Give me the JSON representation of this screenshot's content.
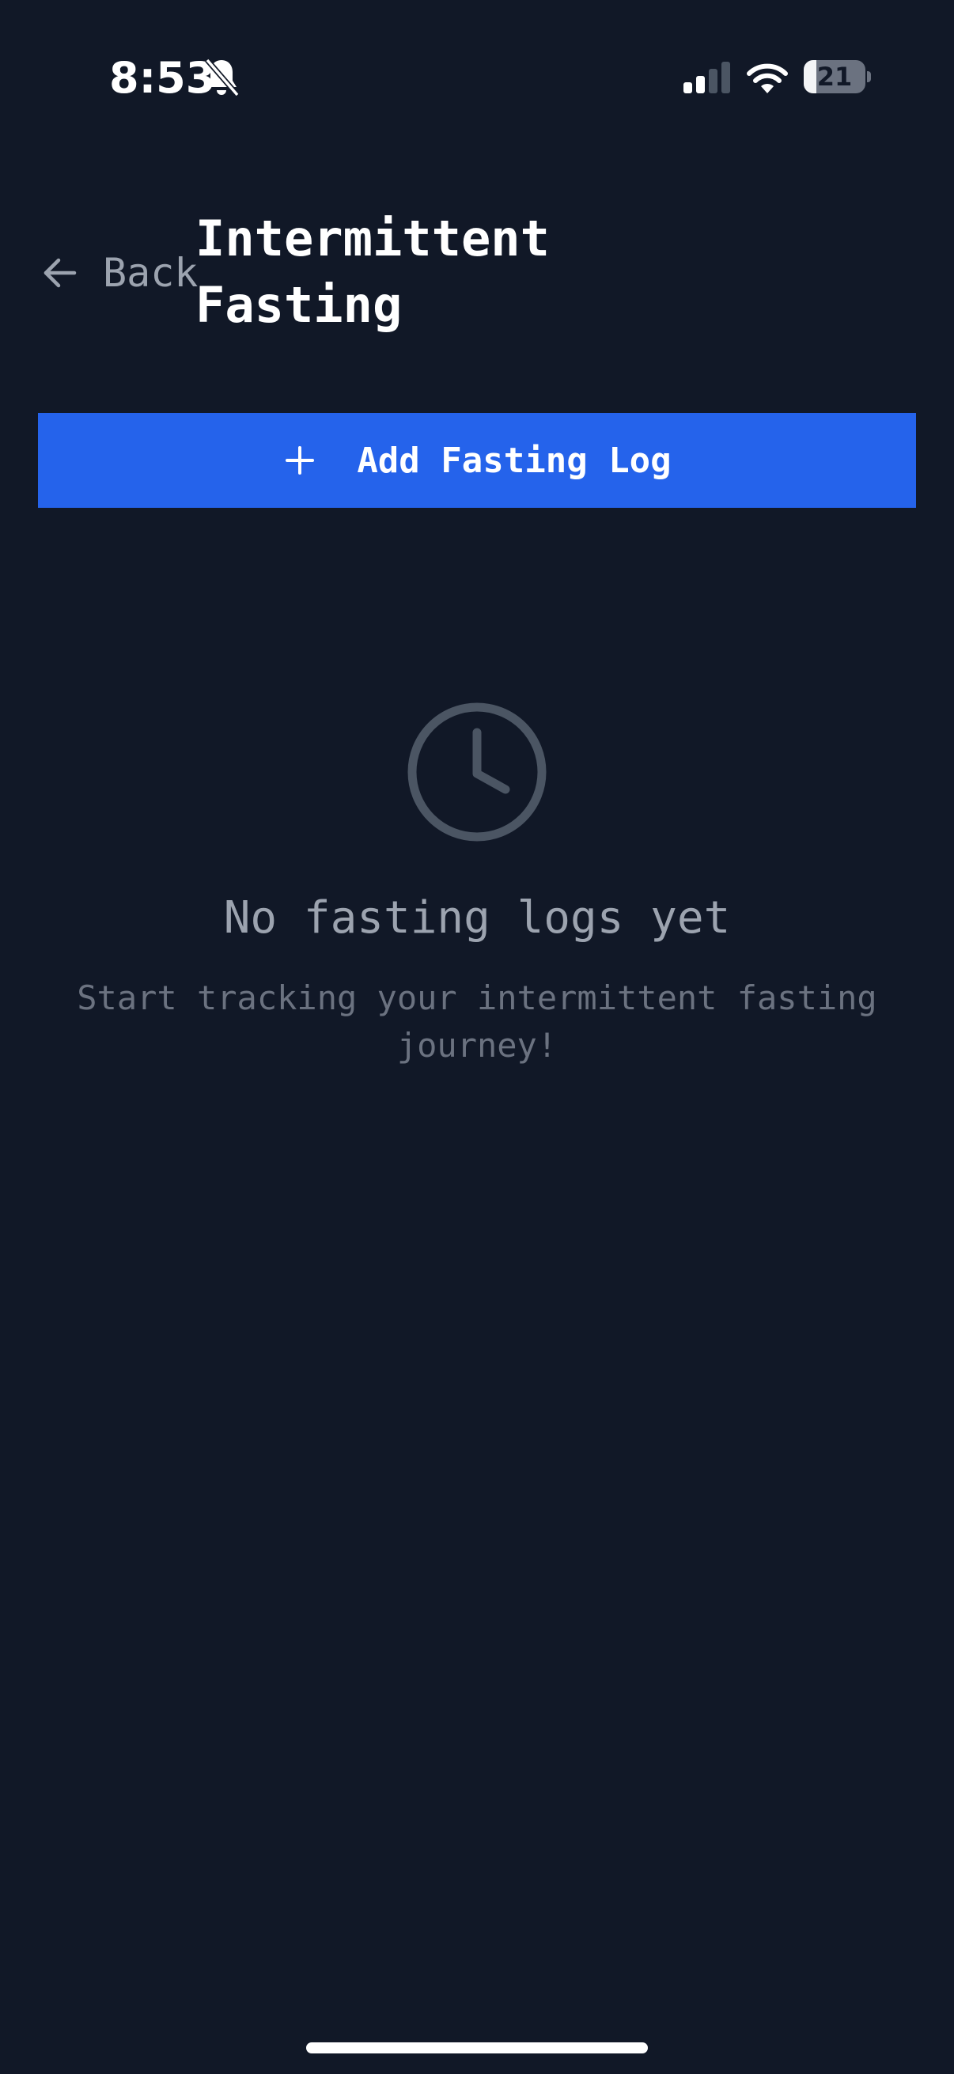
{
  "status_bar": {
    "time": "8:53",
    "battery_level": "21",
    "icons": [
      "bell-slash-icon",
      "cellular-signal-icon",
      "wifi-icon",
      "battery-icon"
    ]
  },
  "header": {
    "back_label": "Back",
    "title": "Intermittent Fasting",
    "back_icon": "arrow-left-icon"
  },
  "actions": {
    "add_label": "Add Fasting Log",
    "add_icon": "plus-icon"
  },
  "empty_state": {
    "icon": "clock-icon",
    "title": "No fasting logs yet",
    "subtitle": "Start tracking your intermittent fasting journey!"
  },
  "colors": {
    "background": "#111827",
    "accent": "#2563eb",
    "muted_text": "#9ca3af",
    "subtle_text": "#6b7280",
    "icon_muted": "#4b5563"
  }
}
